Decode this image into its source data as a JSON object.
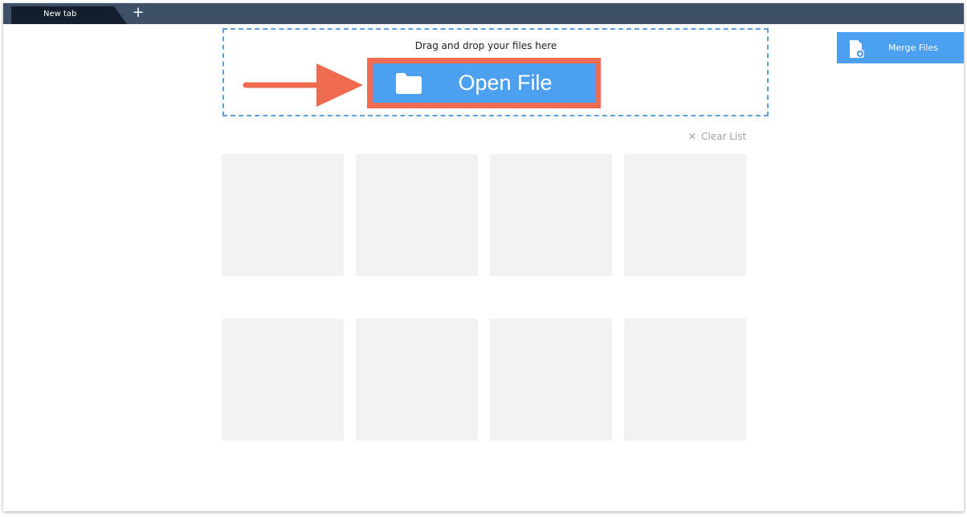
{
  "tabs": [
    {
      "label": "New tab"
    }
  ],
  "new_tab_symbol": "+",
  "drop_zone": {
    "instruction": "Drag and drop your files here"
  },
  "open_file_button": {
    "label": "Open File",
    "icon": "folder-icon"
  },
  "merge_button": {
    "label": "Merge Files",
    "icon": "document-add-icon"
  },
  "clear_list": {
    "label": "Clear List",
    "icon_glyph": "✕"
  },
  "file_tiles": [
    {
      "row": 1,
      "col": 1
    },
    {
      "row": 1,
      "col": 2
    },
    {
      "row": 1,
      "col": 3
    },
    {
      "row": 1,
      "col": 4
    },
    {
      "row": 2,
      "col": 1
    },
    {
      "row": 2,
      "col": 2
    },
    {
      "row": 2,
      "col": 3
    },
    {
      "row": 2,
      "col": 4
    }
  ],
  "colors": {
    "tabbar": "#3e4f68",
    "active_tab": "#141e2e",
    "button_blue": "#4d9ff0",
    "dashed_border": "#5b9fe6",
    "highlight_orange": "#ee6b4f",
    "tile_gray": "#f1f1f1"
  }
}
